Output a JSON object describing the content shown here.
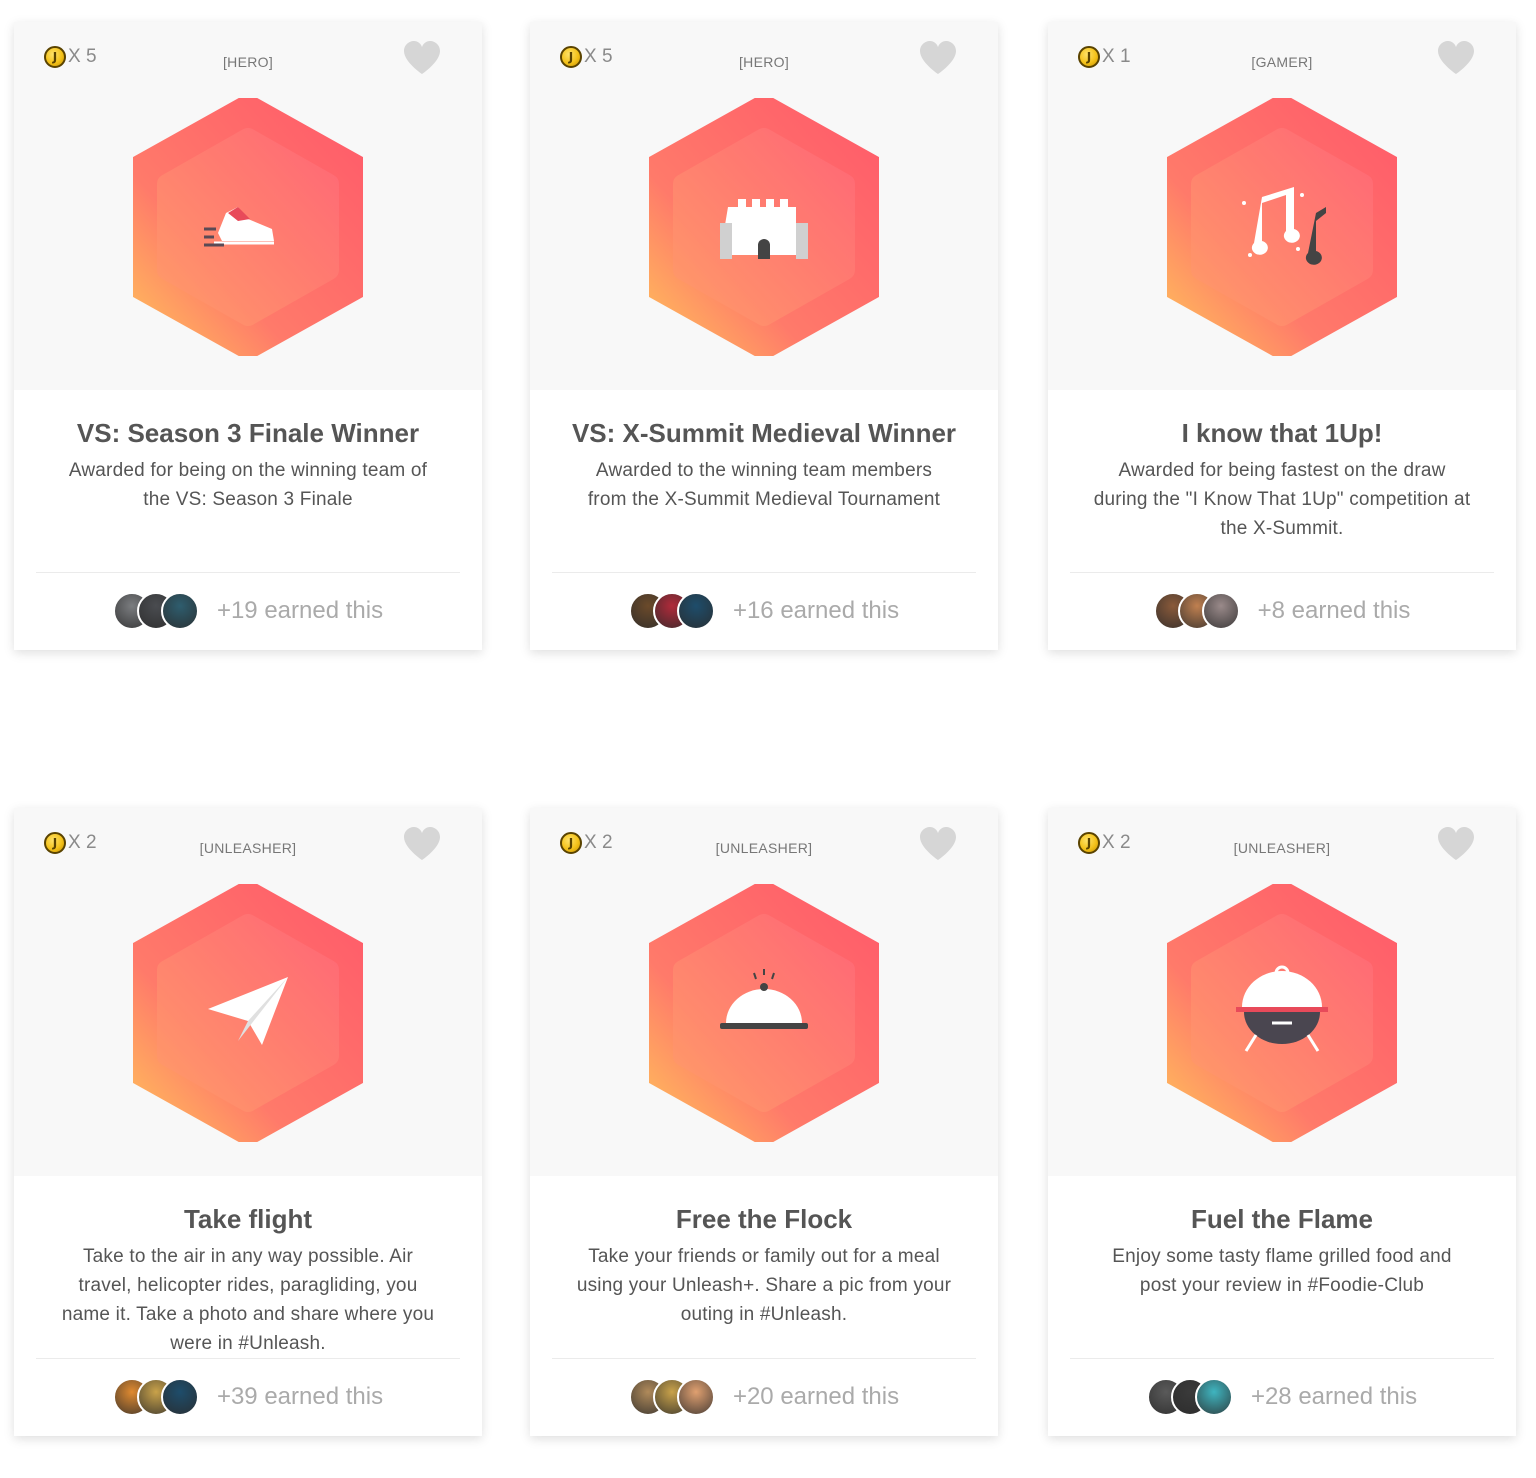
{
  "cards": [
    {
      "coin_count": "X 5",
      "tag": "[HERO]",
      "badge_icon": "running-shoe-icon",
      "title": "VS: Season 3 Finale Winner",
      "desc": "Awarded for being on the winning team of the VS: Season 3 Finale",
      "earned": "+19 earned this",
      "avatars": [
        "#7b7d80",
        "#4a4c50",
        "#2e5d6e"
      ]
    },
    {
      "coin_count": "X 5",
      "tag": "[HERO]",
      "badge_icon": "castle-icon",
      "title": "VS: X-Summit Medieval Winner",
      "desc": "Awarded to the winning team members from the X-Summit Medieval Tournament",
      "earned": "+16 earned this",
      "avatars": [
        "#6b4a2a",
        "#b02a3a",
        "#1e4d6b"
      ]
    },
    {
      "coin_count": "X 1",
      "tag": "[GAMER]",
      "badge_icon": "music-notes-icon",
      "title": "I know that 1Up!",
      "desc": "Awarded for being fastest on the draw during the \"I Know That 1Up\" competition at the X-Summit.",
      "earned": "+8 earned this",
      "avatars": [
        "#8a5a3a",
        "#c08050",
        "#9a8a8a"
      ]
    },
    {
      "coin_count": "X 2",
      "tag": "[UNLEASHER]",
      "badge_icon": "paper-plane-icon",
      "title": "Take flight",
      "desc": "Take to the air in any way possible. Air travel, helicopter rides, paragliding, you name it. Take a photo and share where you were in #Unleash.",
      "earned": "+39 earned this",
      "avatars": [
        "#e08a30",
        "#c9a24a",
        "#1e4d6b"
      ]
    },
    {
      "coin_count": "X 2",
      "tag": "[UNLEASHER]",
      "badge_icon": "food-cloche-icon",
      "title": "Free the Flock",
      "desc": "Take your friends or family out for a meal using your Unleash+. Share a pic from your outing in #Unleash.",
      "earned": "+20 earned this",
      "avatars": [
        "#b08a5a",
        "#c9a24a",
        "#e0a070"
      ]
    },
    {
      "coin_count": "X 2",
      "tag": "[UNLEASHER]",
      "badge_icon": "bbq-grill-icon",
      "title": "Fuel the Flame",
      "desc": "Enjoy some tasty flame grilled food and post your review in #Foodie-Club",
      "earned": "+28 earned this",
      "avatars": [
        "#5a5a5a",
        "#3a3a3a",
        "#3fb5c0"
      ]
    }
  ]
}
